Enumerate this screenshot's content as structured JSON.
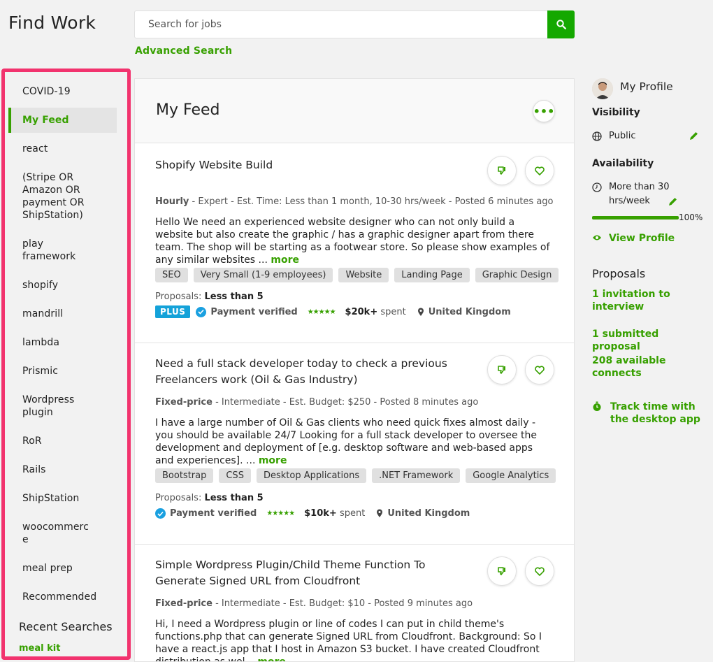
{
  "header": {
    "title": "Find Work",
    "search_placeholder": "Search for jobs",
    "advanced_search": "Advanced Search"
  },
  "sidebar": {
    "items": [
      {
        "label": "COVID-19"
      },
      {
        "label": "My Feed",
        "active": true
      },
      {
        "label": "react"
      },
      {
        "label": "(Stripe OR Amazon OR payment OR ShipStation)"
      },
      {
        "label": "play framework"
      },
      {
        "label": "shopify"
      },
      {
        "label": "mandrill"
      },
      {
        "label": "lambda"
      },
      {
        "label": "Prismic"
      },
      {
        "label": "Wordpress plugin"
      },
      {
        "label": "RoR"
      },
      {
        "label": "Rails"
      },
      {
        "label": "ShipStation"
      },
      {
        "label": "woocommerce"
      },
      {
        "label": "meal prep"
      },
      {
        "label": "Recommended"
      }
    ],
    "recent_searches_title": "Recent Searches",
    "recent_searches": [
      "meal kit"
    ]
  },
  "feed": {
    "title": "My Feed",
    "more_icon": "ellipsis-icon",
    "jobs": [
      {
        "title": "Shopify Website Build",
        "type": "Hourly",
        "meta_rest": " - Expert - Est. Time: Less than 1 month, 10-30 hrs/week - Posted 6 minutes ago",
        "description": "Hello We need an experienced website designer who can not only build a website but also create the graphic / has a graphic designer apart from there team. The shop will be starting as a footwear store. So please show examples of any similar websites ... ",
        "more": "more",
        "tags": [
          "SEO",
          "Very Small (1-9 employees)",
          "Website",
          "Landing Page",
          "Graphic Design"
        ],
        "proposals_label": "Proposals: ",
        "proposals_value": "Less than 5",
        "plus": "PLUS",
        "payment": "Payment verified",
        "stars": "★★★★★",
        "spent_amount": "$20k+",
        "spent_label": " spent",
        "location": "United Kingdom"
      },
      {
        "title": "Need a full stack developer today to check a previous Freelancers work (Oil & Gas Industry)",
        "type": "Fixed-price",
        "meta_rest": " - Intermediate - Est. Budget: $250 - Posted 8 minutes ago",
        "description": "I have a large number of Oil & Gas clients who need quick fixes almost daily - you should be available 24/7 Looking for a full stack developer to oversee the development and deployment of [e.g. desktop software and web-based apps and experiences]. ... ",
        "more": "more",
        "tags": [
          "Bootstrap",
          "CSS",
          "Desktop Applications",
          ".NET Framework",
          "Google Analytics"
        ],
        "proposals_label": "Proposals: ",
        "proposals_value": "Less than 5",
        "payment": "Payment verified",
        "stars": "★★★★★",
        "spent_amount": "$10k+",
        "spent_label": " spent",
        "location": "United Kingdom"
      },
      {
        "title": "Simple Wordpress Plugin/Child Theme Function To Generate Signed URL from Cloudfront",
        "type": "Fixed-price",
        "meta_rest": " - Intermediate - Est. Budget: $10 - Posted 9 minutes ago",
        "description": "Hi, I need a Wordpress plugin or line of codes I can put in child theme's functions.php that can generate Signed URL from Cloudfront. Background: So I have a react.js app that I host in Amazon S3 bucket. I have created Cloudfront distribution as wel... ",
        "more": "more"
      }
    ]
  },
  "profile": {
    "title": "My Profile",
    "visibility_title": "Visibility",
    "visibility_value": "Public",
    "availability_title": "Availability",
    "availability_value": "More than 30 hrs/week",
    "availability_fraction": 1.0,
    "availability_pct": "100%",
    "view_profile": "View Profile",
    "proposals_title": "Proposals",
    "invitations": "1 invitation to interview",
    "submitted": "1 submitted proposal",
    "connects": "208 available connects",
    "track_time": "Track time with the desktop app"
  },
  "colors": {
    "accent": "#37a000",
    "search_button": "#14a800",
    "plus_badge": "#14a2d9",
    "highlight": "#f2336e"
  }
}
